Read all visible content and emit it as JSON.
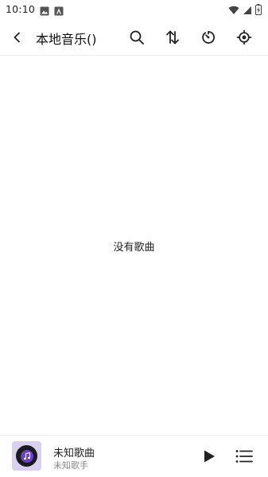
{
  "status_bar": {
    "time": "10:10",
    "left_icons": [
      "image-icon",
      "a-notification-icon"
    ],
    "right_icons": [
      "wifi-icon",
      "signal-icon",
      "battery-charging-icon"
    ]
  },
  "app_bar": {
    "title": "本地音乐()",
    "actions": [
      "search-icon",
      "sort-icon",
      "timer-icon",
      "locate-icon"
    ]
  },
  "main": {
    "empty_text": "没有歌曲"
  },
  "mini_player": {
    "song_title": "未知歌曲",
    "artist": "未知歌手",
    "album_art_color": "#d9cfee",
    "accent_color": "#6b3fd0"
  }
}
